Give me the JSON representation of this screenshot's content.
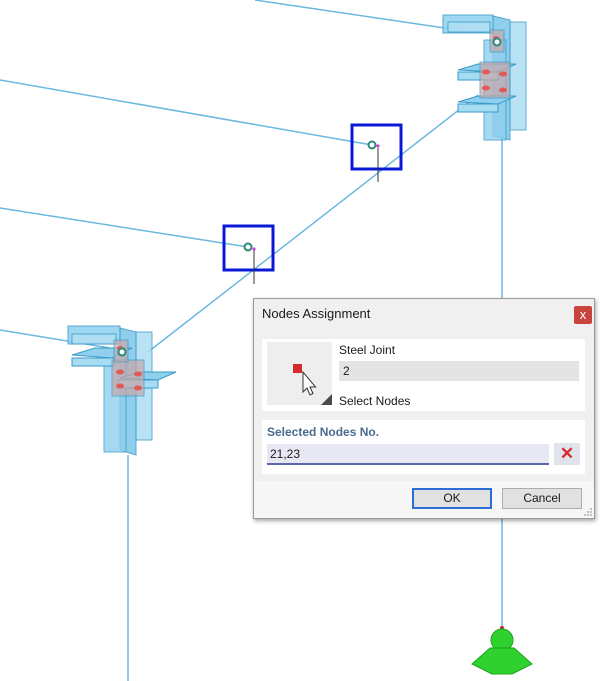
{
  "dialog": {
    "title": "Nodes Assignment",
    "close_symbol": "x",
    "object_label": "Steel Joint",
    "object_value": "2",
    "select_label": "Select Nodes",
    "selected_nodes_label": "Selected Nodes No.",
    "selected_nodes_value": "21,23",
    "clear_symbol": "✕",
    "ok_label": "OK",
    "cancel_label": "Cancel"
  },
  "colors": {
    "member_line": "#6bb8e0",
    "highlight_box": "#0a18d8",
    "node_marker": "#2a8a7a",
    "support": "#2fd12f",
    "joint_fill": "#8fd0ee"
  }
}
